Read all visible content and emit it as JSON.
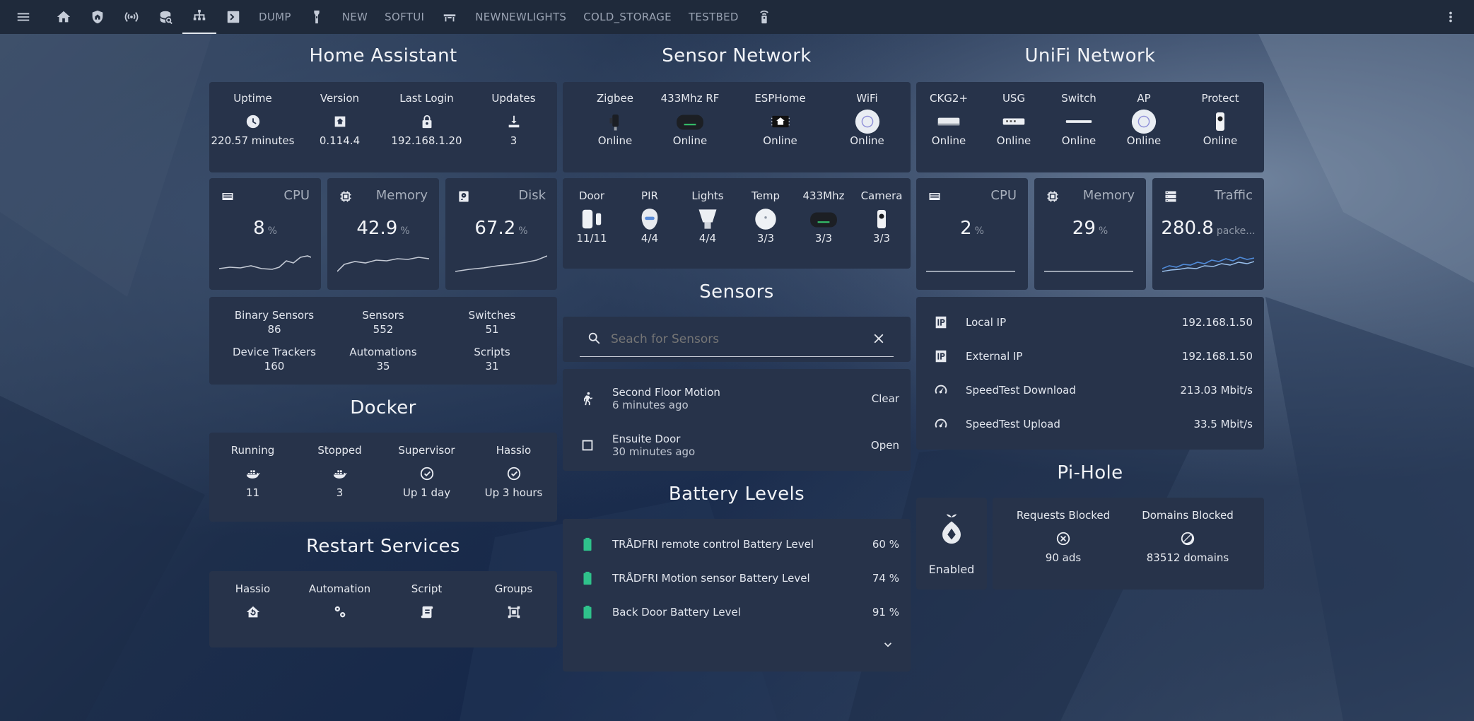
{
  "topbar": {
    "tabs_text": [
      "DUMP",
      "NEW",
      "SOFTUI",
      "NEWNEWLIGHTS",
      "COLD_STORAGE",
      "TESTBED"
    ]
  },
  "home_assistant": {
    "title": "Home Assistant",
    "info": [
      {
        "label": "Uptime",
        "icon": "clock-icon",
        "value": "220.57 minutes"
      },
      {
        "label": "Version",
        "icon": "home-assistant-icon",
        "value": "0.114.4"
      },
      {
        "label": "Last Login",
        "icon": "lock-icon",
        "value": "192.168.1.20"
      },
      {
        "label": "Updates",
        "icon": "download-icon",
        "value": "3"
      }
    ],
    "gauges": [
      {
        "name": "CPU",
        "value": "8",
        "unit": "%"
      },
      {
        "name": "Memory",
        "value": "42.9",
        "unit": "%"
      },
      {
        "name": "Disk",
        "value": "67.2",
        "unit": "%"
      }
    ],
    "counts": [
      {
        "label": "Binary Sensors",
        "value": "86"
      },
      {
        "label": "Sensors",
        "value": "552"
      },
      {
        "label": "Switches",
        "value": "51"
      },
      {
        "label": "Device Trackers",
        "value": "160"
      },
      {
        "label": "Automations",
        "value": "35"
      },
      {
        "label": "Scripts",
        "value": "31"
      }
    ]
  },
  "docker": {
    "title": "Docker",
    "items": [
      {
        "label": "Running",
        "icon": "docker-icon",
        "value": "11"
      },
      {
        "label": "Stopped",
        "icon": "docker-icon",
        "value": "3"
      },
      {
        "label": "Supervisor",
        "icon": "check-circle-icon",
        "value": "Up 1 day"
      },
      {
        "label": "Hassio",
        "icon": "check-circle-icon",
        "value": "Up 3 hours"
      }
    ]
  },
  "restart": {
    "title": "Restart Services",
    "items": [
      {
        "label": "Hassio",
        "icon": "home-restart-icon"
      },
      {
        "label": "Automation",
        "icon": "cogs-icon"
      },
      {
        "label": "Script",
        "icon": "script-icon"
      },
      {
        "label": "Groups",
        "icon": "group-icon"
      }
    ]
  },
  "sensor_network": {
    "title": "Sensor Network",
    "hubs": [
      {
        "label": "Zigbee",
        "value": "Online"
      },
      {
        "label": "433Mhz RF",
        "value": "Online"
      },
      {
        "label": "ESPHome",
        "value": "Online"
      },
      {
        "label": "WiFi",
        "value": "Online"
      }
    ],
    "devices": [
      {
        "label": "Door",
        "value": "11/11"
      },
      {
        "label": "PIR",
        "value": "4/4"
      },
      {
        "label": "Lights",
        "value": "4/4"
      },
      {
        "label": "Temp",
        "value": "3/3"
      },
      {
        "label": "433Mhz",
        "value": "3/3"
      },
      {
        "label": "Camera",
        "value": "3/3"
      }
    ]
  },
  "sensors": {
    "title": "Sensors",
    "search_placeholder": "Seach for Sensors",
    "list": [
      {
        "name": "Second Floor Motion",
        "time": "6 minutes ago",
        "state": "Clear"
      },
      {
        "name": "Ensuite Door",
        "time": "30 minutes ago",
        "state": "Open"
      }
    ]
  },
  "battery": {
    "title": "Battery Levels",
    "list": [
      {
        "name": "TRÅDFRI remote control Battery Level",
        "value": "60 %"
      },
      {
        "name": "TRÅDFRI Motion sensor Battery Level",
        "value": "74 %"
      },
      {
        "name": "Back Door Battery Level",
        "value": "91 %"
      }
    ],
    "accent": "#2fc28b"
  },
  "unifi": {
    "title": "UniFi Network",
    "devices": [
      {
        "label": "CKG2+",
        "value": "Online"
      },
      {
        "label": "USG",
        "value": "Online"
      },
      {
        "label": "Switch",
        "value": "Online"
      },
      {
        "label": "AP",
        "value": "Online"
      },
      {
        "label": "Protect",
        "value": "Online"
      }
    ],
    "gauges": [
      {
        "name": "CPU",
        "value": "2",
        "unit": "%"
      },
      {
        "name": "Memory",
        "value": "29",
        "unit": "%"
      },
      {
        "name": "Traffic",
        "value": "280.8",
        "unit": "packe..."
      }
    ],
    "rows": [
      {
        "label": "Local IP",
        "value": "192.168.1.50",
        "icon": "ip-icon"
      },
      {
        "label": "External IP",
        "value": "192.168.1.50",
        "icon": "ip-icon"
      },
      {
        "label": "SpeedTest Download",
        "value": "213.03 Mbit/s",
        "icon": "speedometer-icon"
      },
      {
        "label": "SpeedTest Upload",
        "value": "33.5 Mbit/s",
        "icon": "speedometer-icon"
      }
    ]
  },
  "pihole": {
    "title": "Pi-Hole",
    "status": "Enabled",
    "stats": [
      {
        "label": "Requests Blocked",
        "value": "90 ads",
        "icon": "close-circle-icon"
      },
      {
        "label": "Domains Blocked",
        "value": "83512 domains",
        "icon": "block-icon"
      }
    ]
  }
}
